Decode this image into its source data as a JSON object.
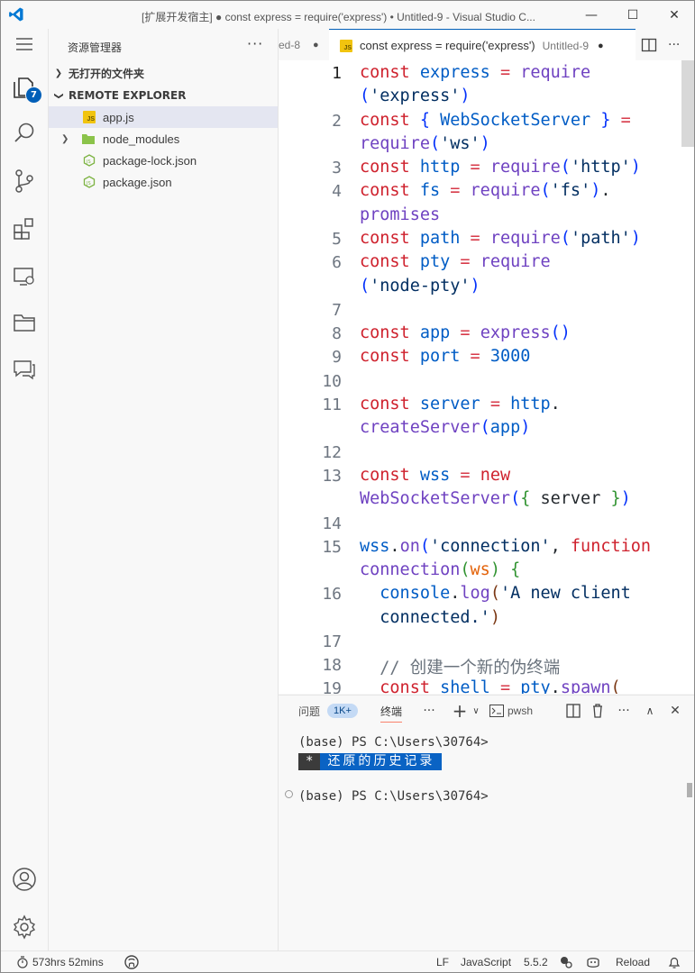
{
  "titlebar": {
    "title": "[扩展开发宿主] ● const express = require('express') • Untitled-9 - Visual Studio C...",
    "minimize": "—",
    "maximize": "☐",
    "close": "✕"
  },
  "activity": {
    "explorer_badge": "7",
    "icons": [
      "explorer-icon",
      "search-icon",
      "source-control-icon",
      "extensions-icon",
      "remote-explorer-icon",
      "folder-icon",
      "chat-icon",
      "account-icon",
      "settings-gear-icon"
    ]
  },
  "sidebar": {
    "title": "资源管理器",
    "more": "···",
    "section_open_editors": "无打开的文件夹",
    "section_remote": "REMOTE EXPLORER",
    "items": [
      {
        "label": "app.js",
        "icon": "js"
      },
      {
        "label": "node_modules",
        "icon": "folder"
      },
      {
        "label": "package-lock.json",
        "icon": "json"
      },
      {
        "label": "package.json",
        "icon": "json"
      }
    ]
  },
  "editor": {
    "prev_tab": "ed-8",
    "active_tab_label": "const express = require('express')",
    "active_tab_desc": "Untitled-9",
    "line_numbers": [
      "1",
      "2",
      "3",
      "4",
      "5",
      "6",
      "7",
      "8",
      "9",
      "10",
      "11",
      "12",
      "13",
      "14",
      "15",
      "16",
      "17",
      "18",
      "19"
    ],
    "comment_text": "// 创建一个新的伪终端"
  },
  "panel": {
    "tab_problems": "问题",
    "problems_badge": "1K+",
    "tab_terminal": "终端",
    "terminal_profile": "pwsh",
    "term_line1": "(base) PS C:\\Users\\30764>",
    "restore_star": "*",
    "restore_text": "还原的历史记录",
    "term_line2": "(base) PS C:\\Users\\30764>"
  },
  "statusbar": {
    "time": "573hrs 52mins",
    "eol": "LF",
    "language": "JavaScript",
    "version": "5.5.2",
    "reload": "Reload"
  },
  "colors": {
    "accent": "#005fb8",
    "keyword": "#cf222e",
    "variable": "#005cc5",
    "function": "#6f42c1",
    "string": "#032f62"
  }
}
